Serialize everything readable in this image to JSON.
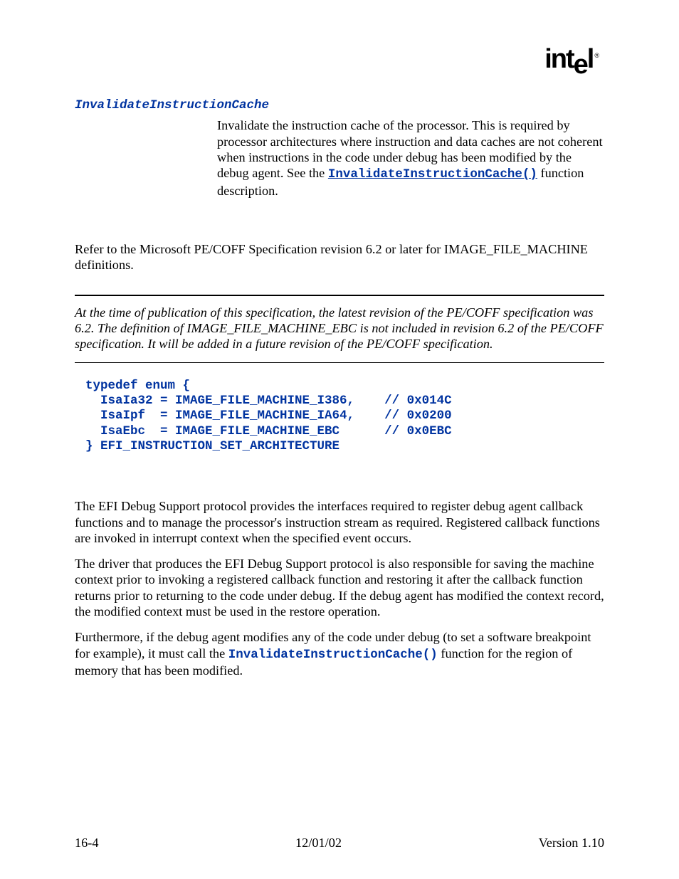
{
  "logo": {
    "pre": "int",
    "drop": "e",
    "post": "l",
    "reg": "®"
  },
  "term": {
    "name": "InvalidateInstructionCache",
    "def_prefix": "Invalidate the instruction cache of the processor.  This is required by processor architectures where instruction and data caches are not coherent when instructions in the code under debug has been modified by the debug agent.  See the ",
    "link": "InvalidateInstructionCache()",
    "def_suffix": " function description."
  },
  "para_ref": "Refer to the Microsoft PE/COFF Specification revision 6.2 or later for IMAGE_FILE_MACHINE definitions.",
  "note": "At the time of publication of this specification, the latest revision of the PE/COFF specification was 6.2.  The definition of IMAGE_FILE_MACHINE_EBC is not included in revision 6.2 of the PE/COFF specification.  It will be added in a future revision of the PE/COFF specification.",
  "code": "typedef enum {\n  IsaIa32 = IMAGE_FILE_MACHINE_I386,    // 0x014C\n  IsaIpf  = IMAGE_FILE_MACHINE_IA64,    // 0x0200\n  IsaEbc  = IMAGE_FILE_MACHINE_EBC      // 0x0EBC\n} EFI_INSTRUCTION_SET_ARCHITECTURE",
  "desc": {
    "p1": "The EFI Debug Support protocol provides the interfaces required to register debug agent callback functions and to manage the processor's instruction stream as required.  Registered callback functions are invoked in interrupt context when the specified event occurs.",
    "p2": "The driver that produces the EFI Debug Support protocol is also responsible for saving the machine context prior to invoking a registered callback function and restoring it after the callback function returns prior to returning to the code under debug.  If the debug agent has modified the context record, the modified context must be used in the restore operation.",
    "p3_pre": "Furthermore, if the debug agent modifies any of the code under debug (to set a software breakpoint for example), it must call the ",
    "p3_code": "InvalidateInstructionCache()",
    "p3_post": " function for the region of memory that has been modified."
  },
  "footer": {
    "left": "16-4",
    "center": "12/01/02",
    "right": "Version 1.10"
  }
}
